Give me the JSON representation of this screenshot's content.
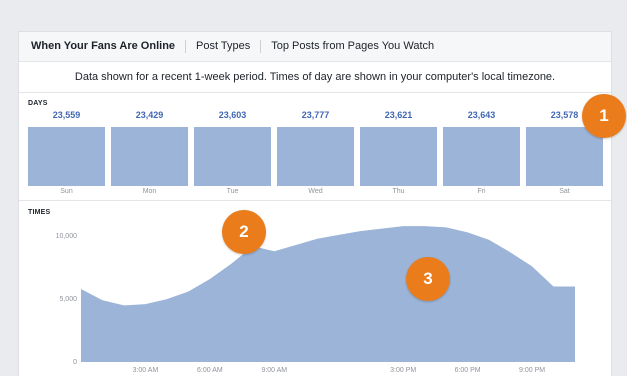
{
  "tabs": [
    {
      "label": "When Your Fans Are Online"
    },
    {
      "label": "Post Types"
    },
    {
      "label": "Top Posts from Pages You Watch"
    }
  ],
  "notice": "Data shown for a recent 1-week period. Times of day are shown in your computer's local timezone.",
  "days": {
    "label": "DAYS",
    "items": [
      {
        "day": "Sun",
        "value": "23,559"
      },
      {
        "day": "Mon",
        "value": "23,429"
      },
      {
        "day": "Tue",
        "value": "23,603"
      },
      {
        "day": "Wed",
        "value": "23,777"
      },
      {
        "day": "Thu",
        "value": "23,621"
      },
      {
        "day": "Fri",
        "value": "23,643"
      },
      {
        "day": "Sat",
        "value": "23,578"
      }
    ]
  },
  "times": {
    "label": "TIMES",
    "y_ticks": [
      "0",
      "5,000",
      "10,000"
    ],
    "x_ticks": [
      "3:00 AM",
      "6:00 AM",
      "9:00 AM",
      "3:00 PM",
      "6:00 PM",
      "9:00 PM"
    ]
  },
  "badges": [
    "1",
    "2",
    "3"
  ],
  "colors": {
    "bar": "#9cb4d8",
    "area": "#9cb4d8",
    "badge": "#ea7c1c",
    "value_text": "#4267b2"
  },
  "chart_data": [
    {
      "type": "bar",
      "categories": [
        "Sun",
        "Mon",
        "Tue",
        "Wed",
        "Thu",
        "Fri",
        "Sat"
      ],
      "values": [
        23559,
        23429,
        23603,
        23777,
        23621,
        23643,
        23578
      ]
    },
    {
      "type": "area",
      "x": [
        0,
        1,
        2,
        3,
        4,
        5,
        6,
        7,
        8,
        9,
        10,
        11,
        12,
        13,
        14,
        15,
        16,
        17,
        18,
        19,
        20,
        21,
        22,
        23
      ],
      "y": [
        5800,
        4900,
        4500,
        4600,
        5000,
        5600,
        6600,
        7800,
        9200,
        8800,
        9300,
        9800,
        10100,
        10400,
        10600,
        10800,
        10800,
        10700,
        10300,
        9700,
        8700,
        7600,
        6000,
        6000
      ],
      "x_tick_labels": [
        "3:00 AM",
        "6:00 AM",
        "9:00 AM",
        "3:00 PM",
        "6:00 PM",
        "9:00 PM"
      ],
      "y_tick_labels": [
        "0",
        "5,000",
        "10,000"
      ],
      "ylim": [
        0,
        12000
      ]
    }
  ]
}
